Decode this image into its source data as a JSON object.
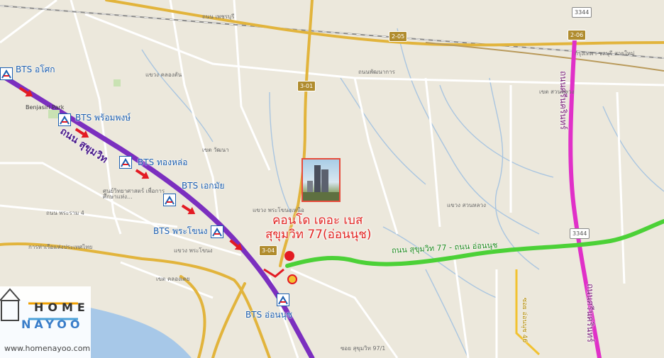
{
  "stations": [
    {
      "label": "BTS อโศก"
    },
    {
      "label": "BTS พร้อมพงษ์"
    },
    {
      "label": "BTS ทองหล่อ"
    },
    {
      "label": "BTS เอกมัย"
    },
    {
      "label": "BTS พระโขนง"
    },
    {
      "label": "BTS อ่อนนุช"
    }
  ],
  "roads": {
    "sukhumvit": "ถนน สุขุมวิท",
    "green_route": "ถนน สุขุมวิท 77 - ถนน อ่อนนุช",
    "srinakarin_1": "ถนนศรีนครินทร์",
    "srinakarin_2": "ถนนศรีนครินทร์",
    "soi_yellow": "ซอย อ่อนนุช 46"
  },
  "condo": {
    "line1": "คอนโด เดอะ เบส",
    "line2": "สุขุมวิท 77(อ่อนนุช)"
  },
  "map_labels": {
    "benjasiri": "Benjasiri Park",
    "phetchaburi": "ถนน เพชรบุรี",
    "motorway": "กรุงเทพฯ-ชลบุรี สายใหม่",
    "phatthanakan": "ถนนพัฒนาการ",
    "suan_luang": "แขวง สวนหลวง",
    "khet_suan_luang": "เขต สวนหลวง",
    "khlong_tan": "แขวง คลองตัน",
    "wattana": "เขต วัฒนา",
    "phra_khanong_nua": "แขวง พระโขนงเหนือ",
    "phra_khanong": "แขวง พระโขนง",
    "khlong_toei": "เขต คลองเตย",
    "science_center": "ศูนย์วิทยาศาสตร์ เพื่อการศึกษาแห่ง...",
    "rama4": "ถนน พระราม 4",
    "port": "การท่าเรือแห่งประเทศไทย",
    "sukhumvit_971": "ซอย สุขุมวิท 97/1"
  },
  "shields": [
    "2-05",
    "2-06",
    "3344",
    "3-01",
    "3-04",
    "3344"
  ],
  "logo": {
    "line1": "HOME",
    "line2": "NAYOO",
    "url": "www.homenayoo.com"
  },
  "colors": {
    "bts_line": "#7b2fbf",
    "green_route": "#4cd137",
    "srinakarin": "#e030c8",
    "arrow": "#e31b23",
    "marker": "#e31b23",
    "highway": "#e2b43c",
    "river": "#a7c8e8"
  }
}
